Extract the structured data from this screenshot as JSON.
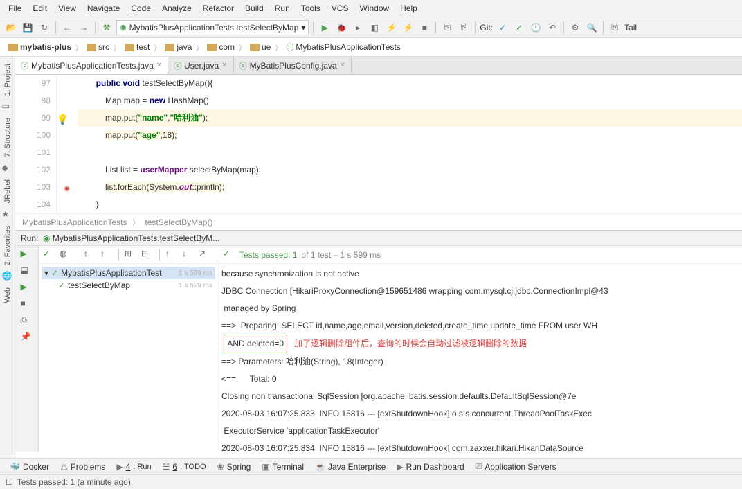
{
  "menu": {
    "file": "File",
    "edit": "Edit",
    "view": "View",
    "navigate": "Navigate",
    "code": "Code",
    "analyze": "Analyze",
    "refactor": "Refactor",
    "build": "Build",
    "run": "Run",
    "tools": "Tools",
    "vcs": "VCS",
    "window": "Window",
    "help": "Help"
  },
  "toolbar": {
    "runconfig": "MybatisPlusApplicationTests.testSelectByMap",
    "git": "Git:",
    "tail": "Tail"
  },
  "breadcrumb": [
    "mybatis-plus",
    "src",
    "test",
    "java",
    "com",
    "ue",
    "MybatisPlusApplicationTests"
  ],
  "tabs": [
    {
      "label": "MybatisPlusApplicationTests.java",
      "active": true
    },
    {
      "label": "User.java",
      "active": false
    },
    {
      "label": "MyBatisPlusConfig.java",
      "active": false
    }
  ],
  "lines": [
    "97",
    "98",
    "99",
    "100",
    "101",
    "102",
    "103",
    "104"
  ],
  "code": {
    "l97a": "public",
    "l97b": "void",
    "l97c": " testSelectByMap(){",
    "l98a": "Map map = ",
    "l98b": "new",
    "l98c": " HashMap();",
    "l99a": "map.put(",
    "l99b": "\"name\"",
    "l99c": ",",
    "l99d": "\"哈利油\"",
    "l99e": ");",
    "l100a": "map.put(",
    "l100b": "\"age\"",
    "l100c": ",18);",
    "l102a": "List list = ",
    "l102b": "userMapper",
    "l102c": ".selectByMap(map);",
    "l103a": "list.forEach(System.",
    "l103b": "out",
    "l103c": "::println);",
    "l104": "}"
  },
  "crumb2": {
    "a": "MybatisPlusApplicationTests",
    "b": "testSelectByMap()"
  },
  "run": {
    "label": "Run:",
    "title": "MybatisPlusApplicationTests.testSelectByM..."
  },
  "teststatus": {
    "prefix": "Tests passed: 1",
    "suffix": " of 1 test – 1 s 599 ms"
  },
  "tree": {
    "root": "MybatisPlusApplicationTest",
    "rootms": "1 s 599 ms",
    "leaf": "testSelectByMap",
    "leafms": "1 s 599 ms"
  },
  "console": {
    "l1": "because synchronization is not active",
    "l2": "JDBC Connection [HikariProxyConnection@159651486 wrapping com.mysql.cj.jdbc.ConnectionImpl@43",
    "l3": " managed by Spring",
    "l4": "==>  Preparing: SELECT id,name,age,email,version,deleted,create_time,update_time FROM user WH",
    "l5box": "AND deleted=0",
    "l5red": "   加了逻辑删除组件后，查询的时候会自动过滤被逻辑删除的数据",
    "l6": "==> Parameters: 哈利油(String), 18(Integer)",
    "l7": "<==      Total: 0",
    "l8": "Closing non transactional SqlSession [org.apache.ibatis.session.defaults.DefaultSqlSession@7e",
    "l9": "2020-08-03 16:07:25.833  INFO 15816 --- [extShutdownHook] o.s.s.concurrent.ThreadPoolTaskExec",
    "l10": " ExecutorService 'applicationTaskExecutor'",
    "l11": "2020-08-03 16:07:25.834  INFO 15816 --- [extShutdownHook] com.zaxxer.hikari.HikariDataSource"
  },
  "bottom": {
    "docker": "Docker",
    "problems": "Problems",
    "run": "4: Run",
    "todo": "6: TODO",
    "spring": "Spring",
    "terminal": "Terminal",
    "je": "Java Enterprise",
    "rd": "Run Dashboard",
    "as": "Application Servers"
  },
  "status": {
    "text": "Tests passed: 1 (a minute ago)"
  },
  "leftTabs": {
    "project": "1: Project",
    "structure": "7: Structure",
    "jrebel": "JRebel",
    "favorites": "2: Favorites",
    "web": "Web"
  }
}
